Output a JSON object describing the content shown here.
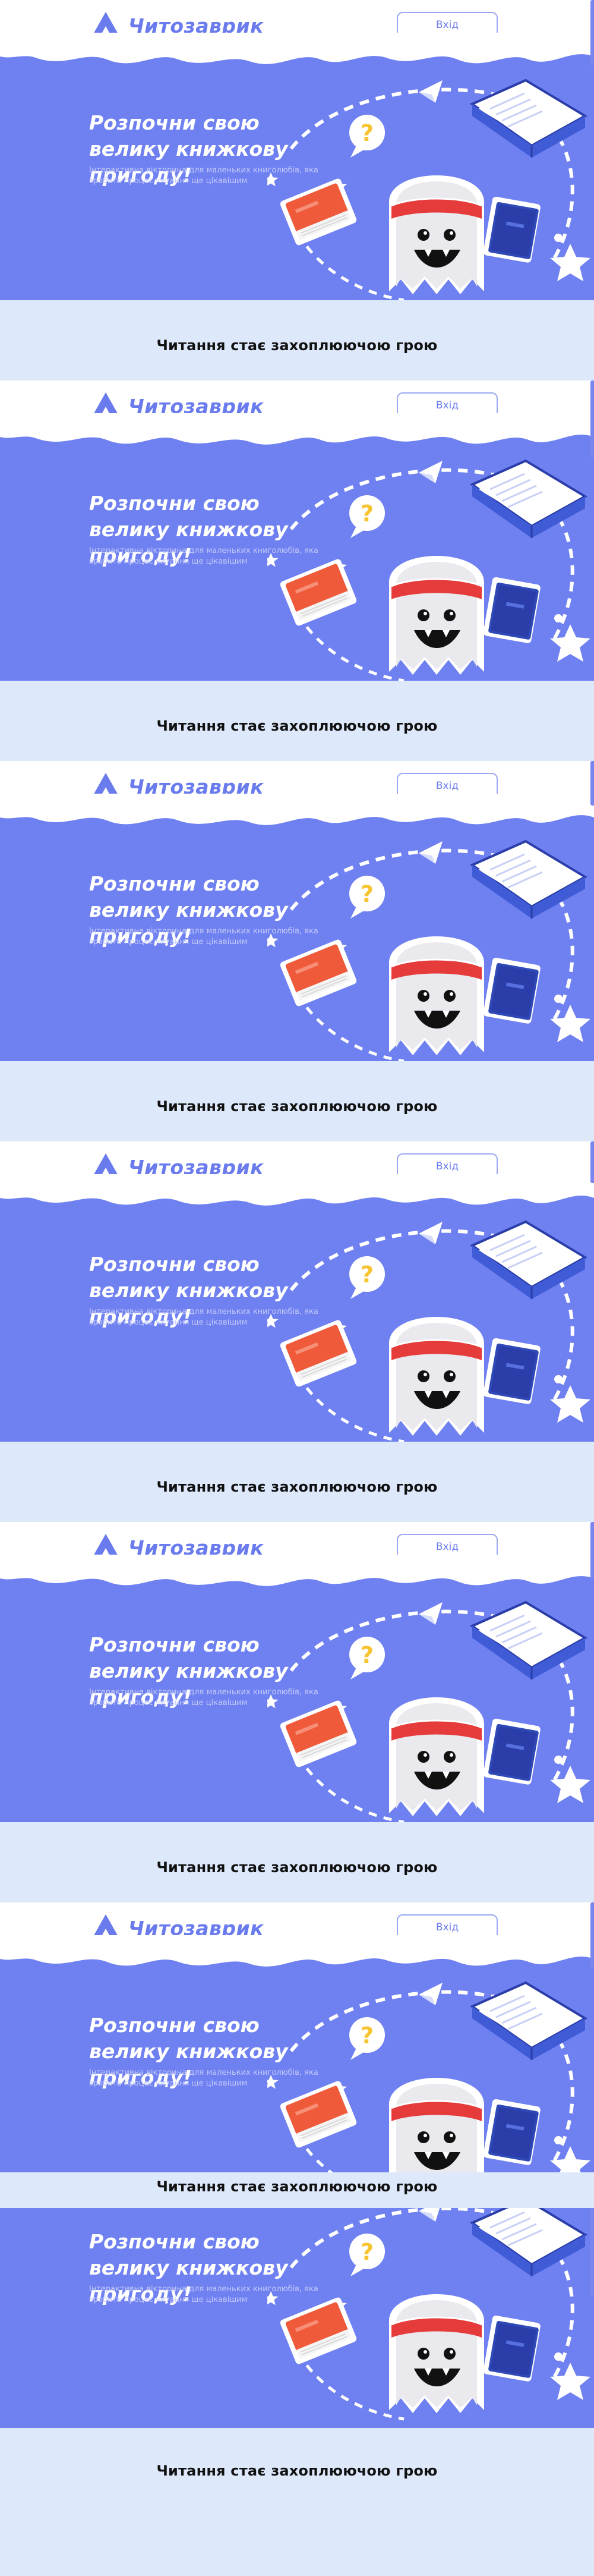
{
  "brand": {
    "name": "Читозаврик"
  },
  "header": {
    "login_label": "Вхід"
  },
  "hero": {
    "title": "Розпочни свою велику книжкову пригоду!",
    "subtitle": "Інтерактивна вікторина для маленьких книголюбів, яка зробить процес читання ще цікавішим",
    "question_mark": "?"
  },
  "tagline": "Читання стає захоплюючою грою",
  "colors": {
    "brand_blue": "#6f80f1",
    "light_band": "#dde9fb",
    "red_book": "#ef5b3a",
    "blue_book": "#2f49b7",
    "headband": "#e53b3b",
    "question_bubble": "#f7c431"
  }
}
